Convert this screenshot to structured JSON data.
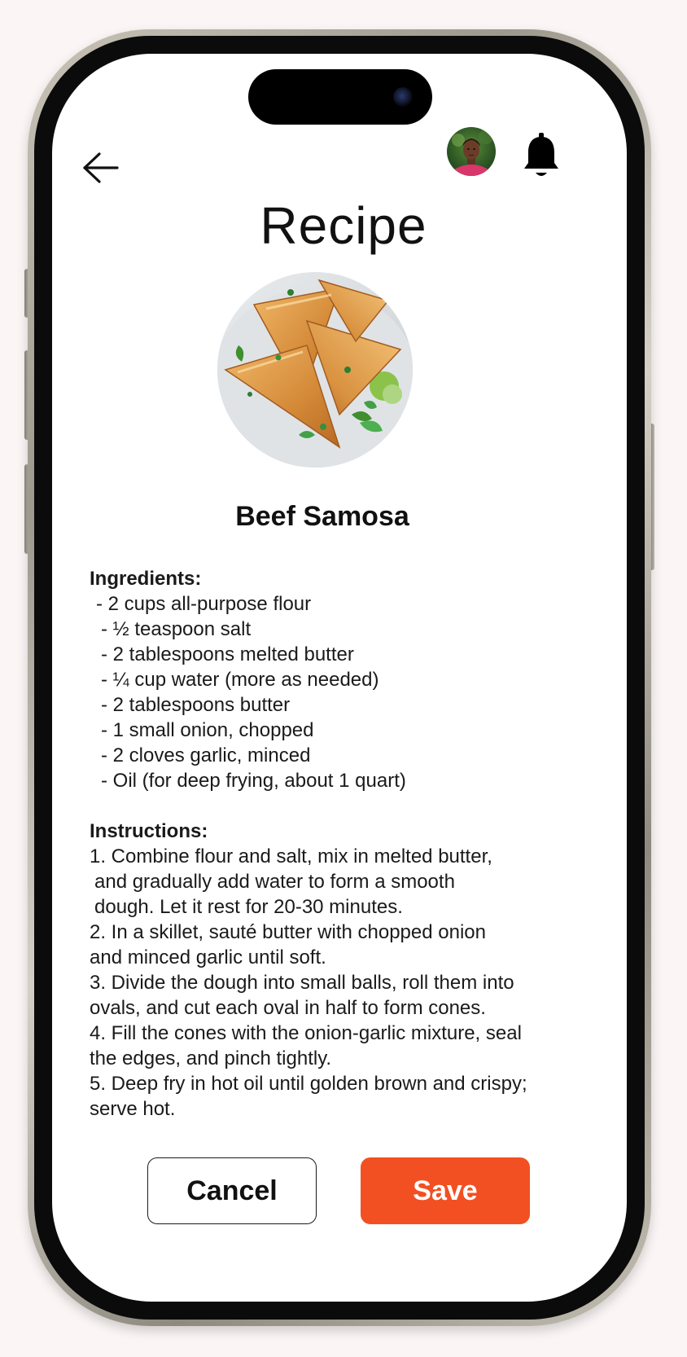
{
  "header": {
    "title": "Recipe",
    "back_icon": "arrow-left-icon",
    "avatar_icon": "user-avatar",
    "notification_icon": "bell-icon"
  },
  "recipe": {
    "name": "Beef Samosa",
    "ingredients_heading": "Ingredients:",
    "ingredients": [
      "- 2 cups all-purpose flour",
      "- ½ teaspoon salt",
      "- 2 tablespoons melted butter",
      "- ¼ cup water (more as needed)",
      "- 2 tablespoons butter",
      "- 1 small onion, chopped",
      "- 2 cloves garlic, minced",
      "- Oil (for deep frying, about 1 quart)"
    ],
    "instructions_heading": "Instructions:",
    "instructions": [
      "1. Combine flour and salt, mix in melted butter,",
      " and gradually add water to form a smooth",
      " dough. Let it rest for 20-30 minutes.",
      "2. In a skillet, sauté butter with chopped onion",
      "and minced garlic until soft.",
      "3. Divide the dough into small balls, roll them into",
      "ovals, and cut each oval in half to form cones.",
      "4. Fill the cones with the onion-garlic mixture, seal",
      "the edges, and pinch tightly.",
      "5. Deep fry in hot oil until golden brown and crispy;",
      "serve hot."
    ]
  },
  "actions": {
    "cancel_label": "Cancel",
    "save_label": "Save"
  },
  "colors": {
    "accent": "#f25022",
    "background": "#fbf6f5",
    "screen": "#ffffff"
  }
}
